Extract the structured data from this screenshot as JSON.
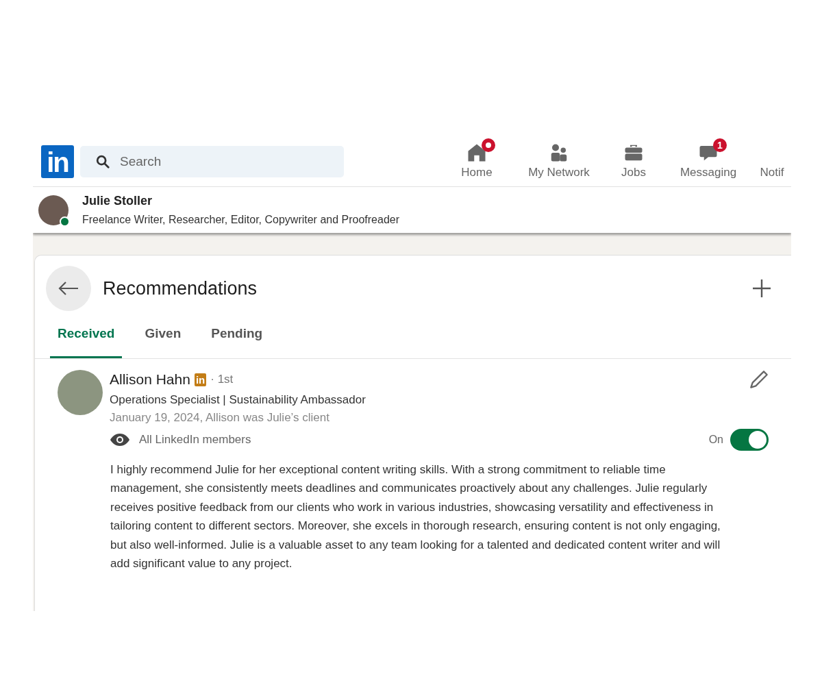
{
  "header": {
    "logo": "in",
    "search": {
      "placeholder": "Search"
    },
    "nav": [
      {
        "kind": "home",
        "label": "Home",
        "dot": true
      },
      {
        "kind": "network",
        "label": "My Network"
      },
      {
        "kind": "jobs",
        "label": "Jobs"
      },
      {
        "kind": "messaging",
        "label": "Messaging",
        "badge": "1"
      },
      {
        "kind": "cut",
        "label": "Notif"
      }
    ]
  },
  "profile": {
    "name": "Julie Stoller",
    "headline": "Freelance Writer, Researcher, Editor, Copywriter and Proofreader",
    "online": true
  },
  "card": {
    "title": "Recommendations",
    "tabs": [
      {
        "label": "Received",
        "selected": true
      },
      {
        "label": "Given",
        "selected": false
      },
      {
        "label": "Pending",
        "selected": false
      }
    ],
    "recommendation": {
      "name": "Allison Hahn",
      "badge": "in",
      "degree": "· 1st",
      "headline": "Operations Specialist | Sustainability Ambassador",
      "meta": "January 19, 2024, Allison was Julie’s client",
      "visibility": "All LinkedIn members",
      "toggle": {
        "label": "On",
        "on": true
      },
      "text": "I highly recommend Julie for her exceptional content writing skills. With a strong commitment to reliable time management, she consistently meets deadlines and communicates proactively about any challenges. Julie regularly receives positive feedback from our clients who work in various industries, showcasing versatility and effectiveness in tailoring content to different sectors. Moreover, she excels in thorough research, ensuring content is not only engaging, but also well-informed. Julie is a valuable asset to any team looking for a talented and dedicated content writer and will add significant value to any project."
    }
  }
}
